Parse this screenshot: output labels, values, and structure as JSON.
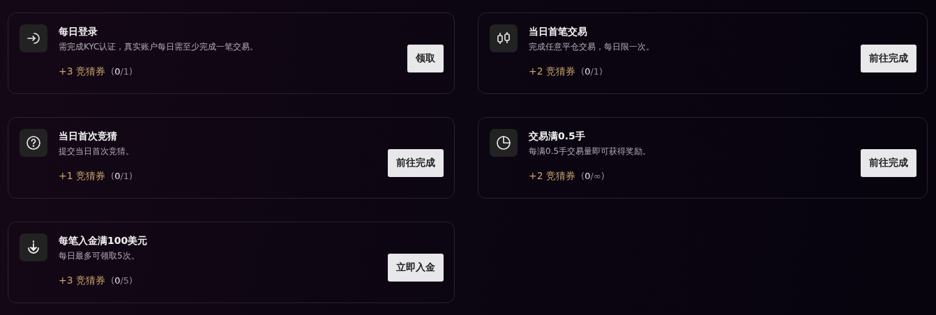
{
  "tasks": [
    {
      "title": "每日登录",
      "description": "需完成KYC认证，真实账户每日需至少完成一笔交易。",
      "reward": "+3 竞猜券",
      "progress": "(**0**/1)",
      "button": "领取"
    },
    {
      "title": "当日首笔交易",
      "description": "完成任意平仓交易，每日限一次。",
      "reward": "+2 竞猜券",
      "progress": "(**0**/1)",
      "button": "前往完成"
    },
    {
      "title": "当日首次竞猜",
      "description": "提交当日首次竞猜。",
      "reward": "+1 竞猜券",
      "progress": "(**0**/1)",
      "button": "前往完成"
    },
    {
      "title": "交易满0.5手",
      "description": "每满0.5手交易量即可获得奖励。",
      "reward": "+2 竞猜券",
      "progress": "(**0**/∞)",
      "button": "前往完成"
    },
    {
      "title": "每笔入金满100美元",
      "description": "每日最多可领取5次。",
      "reward": "+3 竞猜券",
      "progress": "(**0**/5)",
      "button": "立即入金"
    }
  ]
}
